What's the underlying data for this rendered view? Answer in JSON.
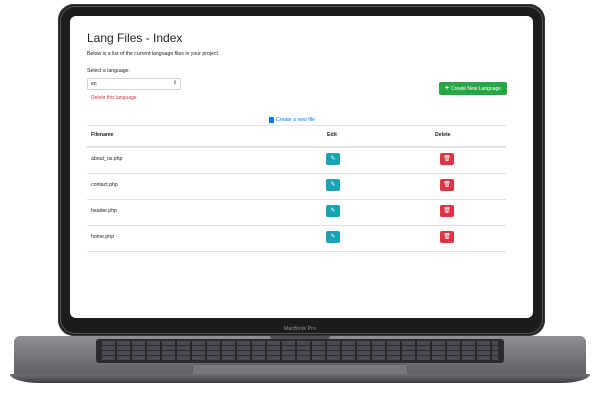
{
  "device": {
    "label": "MacBook Pro"
  },
  "page": {
    "title": "Lang Files - Index",
    "subtitle": "Below is a list of the current language files in your project.",
    "select_label": "Select a language:",
    "selected_language": "en",
    "delete_language": "Delete this language",
    "create_language": "Create New Language",
    "create_file": "Create a new file"
  },
  "table": {
    "headers": {
      "filename": "Filename",
      "edit": "Edit",
      "delete": "Delete"
    },
    "rows": [
      {
        "filename": "about_us.php"
      },
      {
        "filename": "contact.php"
      },
      {
        "filename": "header.php"
      },
      {
        "filename": "home.php"
      }
    ]
  },
  "colors": {
    "primary": "#007bff",
    "success": "#28a745",
    "info": "#17a2b8",
    "danger": "#dc3545"
  },
  "icons": {
    "edit": "edit-icon",
    "delete": "trash-icon",
    "file": "file-icon",
    "plus": "plus-icon",
    "caret": "select-caret-icon"
  }
}
